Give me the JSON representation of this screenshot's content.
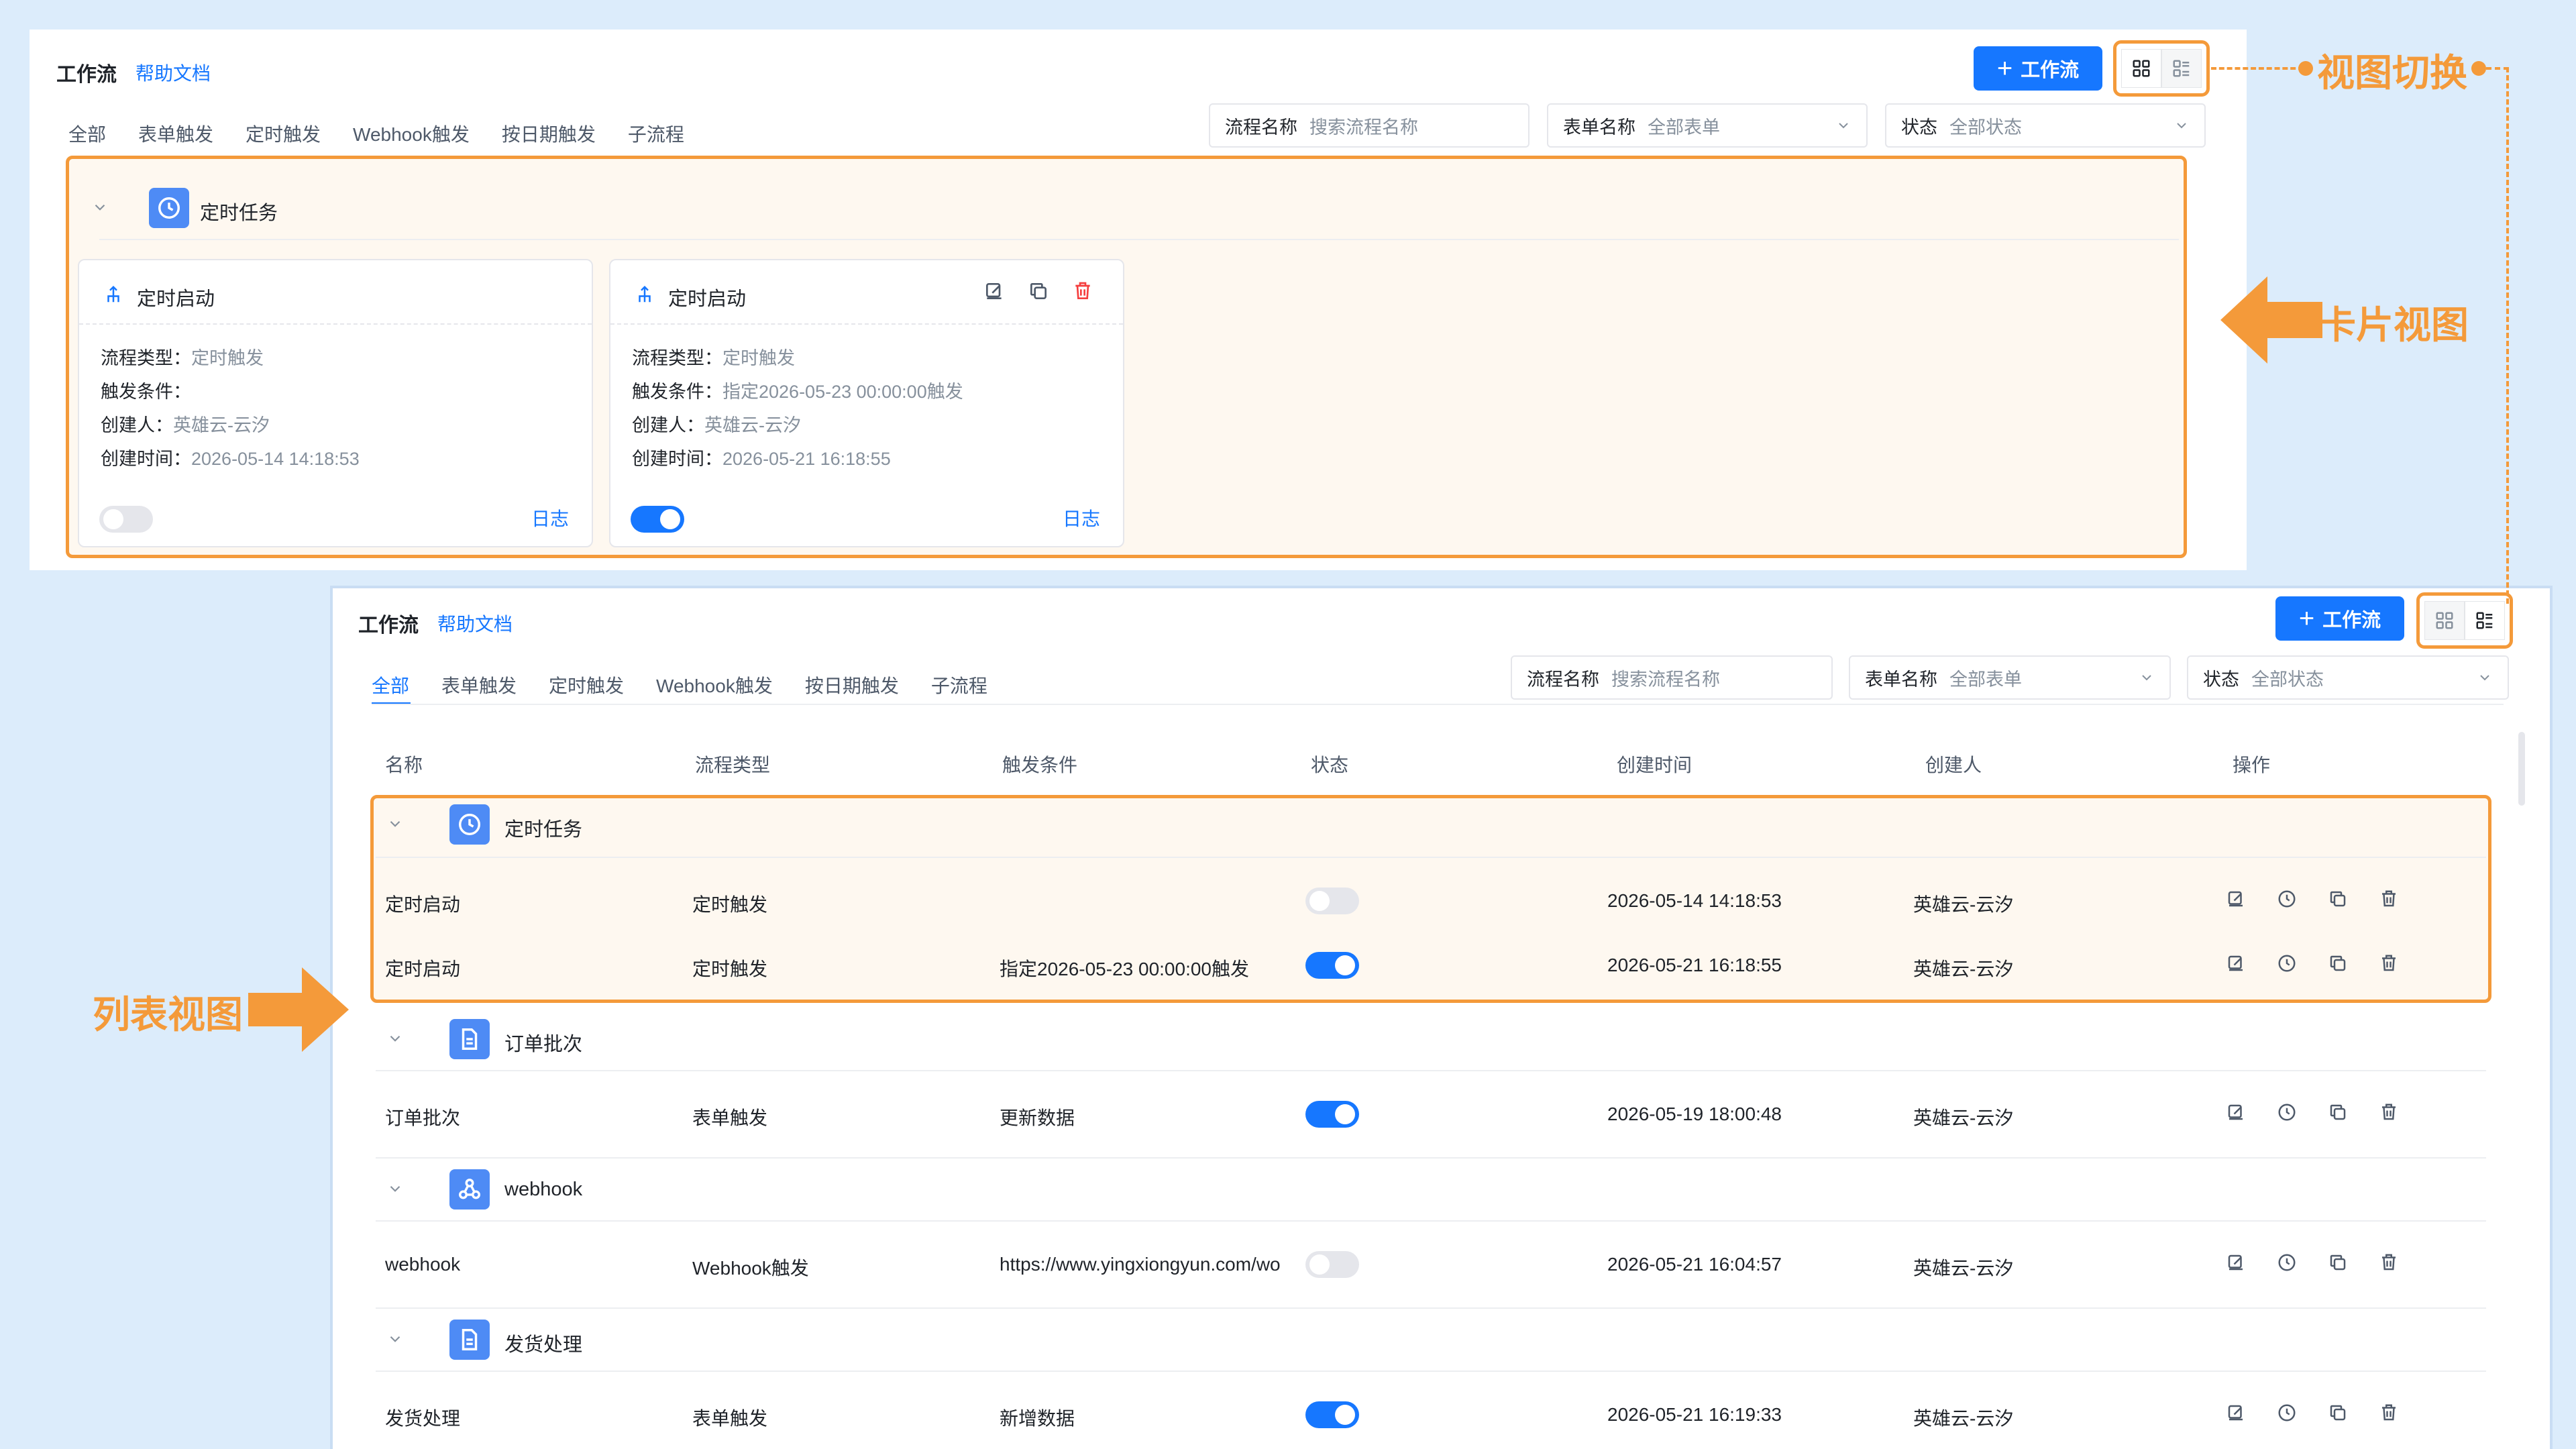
{
  "header": {
    "title": "工作流",
    "help": "帮助文档",
    "add_label": "工作流"
  },
  "tabs": [
    "全部",
    "表单触发",
    "定时触发",
    "Webhook触发",
    "按日期触发",
    "子流程"
  ],
  "filters": {
    "name": {
      "label": "流程名称",
      "placeholder": "搜索流程名称"
    },
    "form": {
      "label": "表单名称",
      "value": "全部表单"
    },
    "status": {
      "label": "状态",
      "value": "全部状态"
    }
  },
  "card_view": {
    "group": {
      "name": "定时任务"
    },
    "cards": [
      {
        "title": "定时启动",
        "type_label": "流程类型：",
        "type": "定时触发",
        "cond_label": "触发条件：",
        "cond": "",
        "creator_label": "创建人：",
        "creator": "英雄云-云汐",
        "time_label": "创建时间：",
        "time": "2026-05-14 14:18:53",
        "enabled": false,
        "log": "日志"
      },
      {
        "title": "定时启动",
        "type_label": "流程类型：",
        "type": "定时触发",
        "cond_label": "触发条件：",
        "cond": "指定2026-05-23 00:00:00触发",
        "creator_label": "创建人：",
        "creator": "英雄云-云汐",
        "time_label": "创建时间：",
        "time": "2026-05-21 16:18:55",
        "enabled": true,
        "log": "日志"
      }
    ]
  },
  "list_view": {
    "columns": [
      "名称",
      "流程类型",
      "触发条件",
      "状态",
      "创建时间",
      "创建人",
      "操作"
    ],
    "groups": [
      {
        "name": "定时任务",
        "icon": "clock-icon",
        "rows": [
          {
            "name": "定时启动",
            "type": "定时触发",
            "cond": "",
            "enabled": false,
            "time": "2026-05-14 14:18:53",
            "creator": "英雄云-云汐"
          },
          {
            "name": "定时启动",
            "type": "定时触发",
            "cond": "指定2026-05-23 00:00:00触发",
            "enabled": true,
            "time": "2026-05-21 16:18:55",
            "creator": "英雄云-云汐"
          }
        ]
      },
      {
        "name": "订单批次",
        "icon": "document-icon",
        "rows": [
          {
            "name": "订单批次",
            "type": "表单触发",
            "cond": "更新数据",
            "enabled": true,
            "time": "2026-05-19 18:00:48",
            "creator": "英雄云-云汐"
          }
        ]
      },
      {
        "name": "webhook",
        "icon": "webhook-icon",
        "rows": [
          {
            "name": "webhook",
            "type": "Webhook触发",
            "cond": "https://www.yingxiongyun.com/wo",
            "enabled": false,
            "time": "2026-05-21 16:04:57",
            "creator": "英雄云-云汐"
          }
        ]
      },
      {
        "name": "发货处理",
        "icon": "document-icon",
        "rows": [
          {
            "name": "发货处理",
            "type": "表单触发",
            "cond": "新增数据",
            "enabled": true,
            "time": "2026-05-21 16:19:33",
            "creator": "英雄云-云汐"
          }
        ]
      }
    ]
  },
  "annotations": {
    "view_switch": "视图切换",
    "card_view": "卡片视图",
    "list_view": "列表视图"
  },
  "colors": {
    "accent": "#1677ff",
    "highlight": "#f49a3a",
    "background": "#dcecfb"
  }
}
